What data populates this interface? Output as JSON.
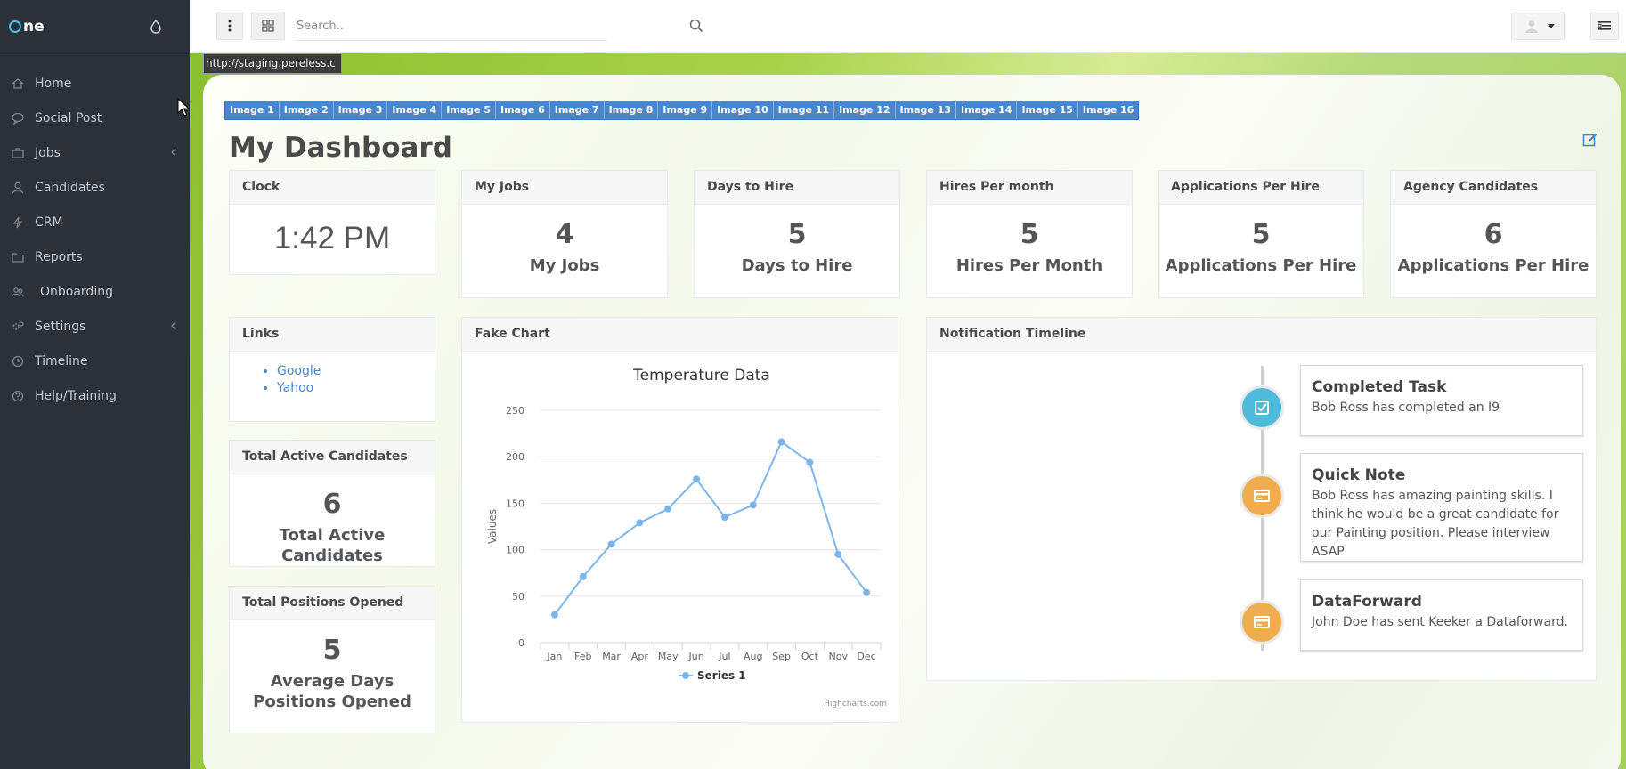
{
  "app": {
    "logo_text": "ne"
  },
  "sidebar": {
    "items": [
      {
        "label": "Home"
      },
      {
        "label": "Social Post"
      },
      {
        "label": "Jobs"
      },
      {
        "label": "Candidates"
      },
      {
        "label": "CRM"
      },
      {
        "label": "Reports"
      },
      {
        "label": "Onboarding"
      },
      {
        "label": "Settings"
      },
      {
        "label": "Timeline"
      },
      {
        "label": "Help/Training"
      }
    ]
  },
  "header": {
    "search_placeholder": "Search.."
  },
  "url_tooltip": "http://staging.pereless.c",
  "image_tabs": [
    "Image 1",
    "Image 2",
    "Image 3",
    "Image 4",
    "Image 5",
    "Image 6",
    "Image 7",
    "Image 8",
    "Image 9",
    "Image 10",
    "Image 11",
    "Image 12",
    "Image 13",
    "Image 14",
    "Image 15",
    "Image 16"
  ],
  "page_title": "My Dashboard",
  "widgets": {
    "clock": {
      "title": "Clock",
      "time": "1:42 PM"
    },
    "my_jobs": {
      "title": "My Jobs",
      "value": "4",
      "label": "My Jobs"
    },
    "days_to_hire": {
      "title": "Days to Hire",
      "value": "5",
      "label": "Days to Hire"
    },
    "hires_per_month": {
      "title": "Hires Per month",
      "value": "5",
      "label": "Hires Per Month"
    },
    "apps_per_hire": {
      "title": "Applications Per Hire",
      "value": "5",
      "label": "Applications Per Hire"
    },
    "agency_candidates": {
      "title": "Agency Candidates",
      "value": "6",
      "label": "Applications Per Hire"
    },
    "links": {
      "title": "Links",
      "items": [
        "Google",
        "Yahoo"
      ]
    },
    "total_active": {
      "title": "Total Active Candidates",
      "value": "6",
      "label": "Total Active Candidates"
    },
    "total_positions": {
      "title": "Total Positions Opened",
      "value": "5",
      "label": "Average Days Positions Opened"
    },
    "fake_chart": {
      "title": "Fake Chart",
      "credit": "Highcharts.com"
    },
    "timeline": {
      "title": "Notification Timeline",
      "events": [
        {
          "title": "Completed Task",
          "body": "Bob Ross has completed an I9",
          "color": "#4fbbdc"
        },
        {
          "title": "Quick Note",
          "body": "Bob Ross has amazing painting skills. I think he would be a great candidate for our Painting position. Please interview ASAP",
          "color": "#f0ad4e"
        },
        {
          "title": "DataForward",
          "body": "John Doe has sent Keeker a Dataforward.",
          "color": "#f0ad4e"
        }
      ]
    }
  },
  "chart_data": {
    "type": "line",
    "title": "Temperature Data",
    "ylabel": "Values",
    "xlabel": "",
    "categories": [
      "Jan",
      "Feb",
      "Mar",
      "Apr",
      "May",
      "Jun",
      "Jul",
      "Aug",
      "Sep",
      "Oct",
      "Nov",
      "Dec"
    ],
    "series": [
      {
        "name": "Series 1",
        "values": [
          30,
          71,
          106,
          129,
          144,
          176,
          135,
          148,
          216,
          194,
          95,
          54
        ]
      }
    ],
    "ylim": [
      0,
      250
    ],
    "yticks": [
      0,
      50,
      100,
      150,
      200,
      250
    ],
    "grid": true,
    "legend": "bottom",
    "color": "#7cb5ec"
  }
}
